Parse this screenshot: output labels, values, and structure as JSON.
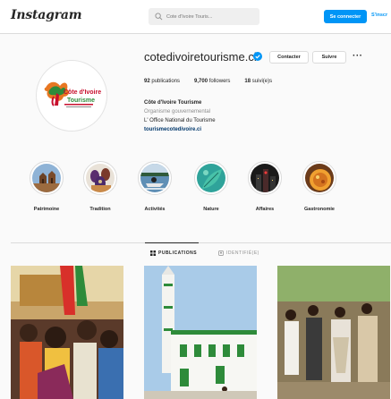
{
  "nav": {
    "logo": "Instagram",
    "search_placeholder": "Cote d'Ivoire Touris...",
    "login_label": "Se connecter",
    "signup_label": "S'inscr"
  },
  "profile": {
    "username": "cotedivoiretourisme.ci",
    "contact_label": "Contacter",
    "follow_label": "Suivre",
    "more_label": "···",
    "stats": {
      "publications_count": "92",
      "publications_label": "publications",
      "followers_count": "9,700",
      "followers_label": "followers",
      "following_count": "18",
      "following_label": "suivi(e)s"
    },
    "bio": {
      "name": "Côte d'Ivoire Tourisme",
      "category": "Organisme gouvernemental",
      "description": "L' Office National du Tourisme",
      "url": "tourismecotedivoire.ci"
    },
    "avatar_logo": {
      "line1": "Côte d'Ivoire",
      "line2": "Tourisme",
      "brand_orange": "#e87722",
      "brand_green": "#2e8b3a",
      "brand_red": "#c8102e"
    }
  },
  "highlights": [
    {
      "label": "Patrimoine",
      "icon": "heritage-building-icon"
    },
    {
      "label": "Tradition",
      "icon": "traditional-masks-icon"
    },
    {
      "label": "Activités",
      "icon": "jetski-icon"
    },
    {
      "label": "Nature",
      "icon": "nature-leaf-icon"
    },
    {
      "label": "Affaires",
      "icon": "city-night-icon"
    },
    {
      "label": "Gastronomie",
      "icon": "food-dish-icon"
    }
  ],
  "tabs": {
    "publications": "PUBLICATIONS",
    "tagged": "IDENTIFIÉ(E)"
  },
  "colors": {
    "accent": "#0095f6",
    "border": "#dbdbdb",
    "text": "#262626",
    "muted": "#8e8e8e",
    "link": "#00376b"
  }
}
